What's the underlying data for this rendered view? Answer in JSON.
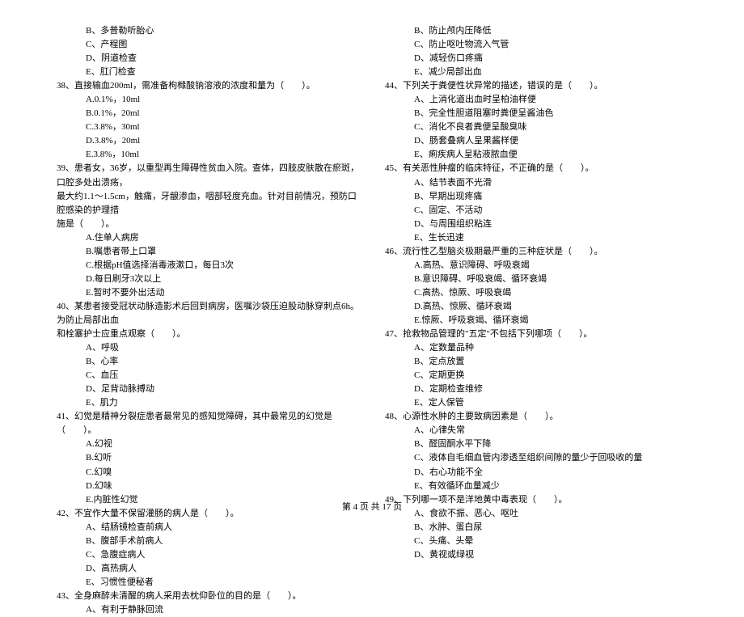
{
  "left": {
    "pre_opts": [
      "B、多普勒听胎心",
      "C、产程图",
      "D、阴道检查",
      "E、肛门检查"
    ],
    "q38": "38、直接输血200ml，需准备枸橼酸钠溶液的浓度和量为（　　）。",
    "q38_opts": [
      "A.0.1%，10ml",
      "B.0.1%，20ml",
      "C.3.8%，30ml",
      "D.3.8%，20ml",
      "E.3.8%，10ml"
    ],
    "q39a": "39、患者女，36岁，以重型再生障碍性贫血入院。查体，四肢皮肤散在瘀斑，口腔多处出溃疡，",
    "q39b": "最大约1.1～1.5cm，触痛，牙龈渗血，咽部轻度充血。针对目前情况，预防口腔感染的护理措",
    "q39c": "施是（　　）。",
    "q39_opts": [
      "A.住单人病房",
      "B.嘱患者带上口罩",
      "C.根据pH值选择消毒液漱口，每日3次",
      "D.每日刷牙3次以上",
      "E.暂时不要外出活动"
    ],
    "q40a": "40、某患者接受冠状动脉造影术后回到病房，医嘱沙袋压迫股动脉穿刺点6h。为防止局部出血",
    "q40b": "和栓塞护士应重点观察（　　）。",
    "q40_opts": [
      "A、呼吸",
      "B、心率",
      "C、血压",
      "D、足背动脉搏动",
      "E、肌力"
    ],
    "q41": "41、幻觉是精神分裂症患者最常见的感知觉障碍，其中最常见的幻觉是（　　）。",
    "q41_opts": [
      "A.幻视",
      "B.幻听",
      "C.幻嗅",
      "D.幻味",
      "E.内脏性幻觉"
    ],
    "q42": "42、不宜作大量不保留灌肠的病人是（　　）。",
    "q42_opts": [
      "A、结肠镜检查前病人",
      "B、腹部手术前病人",
      "C、急腹症病人",
      "D、高热病人",
      "E、习惯性便秘者"
    ],
    "q43": "43、全身麻醉未清醒的病人采用去枕仰卧位的目的是（　　）。",
    "q43_opts": [
      "A、有利于静脉回流"
    ]
  },
  "right": {
    "pre_opts": [
      "B、防止颅内压降低",
      "C、防止呕吐物流入气管",
      "D、减轻伤口疼痛",
      "E、减少局部出血"
    ],
    "q44": "44、下列关于粪便性状异常的描述，错误的是（　　）。",
    "q44_opts": [
      "A、上消化道出血时呈柏油样便",
      "B、完全性胆道阻塞时粪便呈酱油色",
      "C、消化不良者粪便呈酸臭味",
      "D、肠套叠病人呈果酱样便",
      "E、痢疾病人呈粘液脓血便"
    ],
    "q45": "45、有关恶性肿瘤的临床特征，不正确的是（　　）。",
    "q45_opts": [
      "A、结节表面不光滑",
      "B、早期出现疼痛",
      "C、固定、不活动",
      "D、与周围组织粘连",
      "E、生长迅速"
    ],
    "q46": "46、流行性乙型脑炎极期最严重的三种症状是（　　）。",
    "q46_opts": [
      "A.高热、意识障碍、呼吸衰竭",
      "B.意识障碍、呼吸衰竭、循环衰竭",
      "C.高热、惊厥、呼吸衰竭",
      "D.高热、惊厥、循环衰竭",
      "E.惊厥、呼吸衰竭、循环衰竭"
    ],
    "q47": "47、抢救物品管理的\"五定\"不包括下列哪项（　　）。",
    "q47_opts": [
      "A、定数量品种",
      "B、定点放置",
      "C、定期更换",
      "D、定期检查维修",
      "E、定人保管"
    ],
    "q48": "48、心源性水肿的主要致病因素是（　　）。",
    "q48_opts": [
      "A、心律失常",
      "B、醛固酮水平下降",
      "C、液体自毛细血管内渗透至组织间隙的量少于回吸收的量",
      "D、右心功能不全",
      "E、有效循环血量减少"
    ],
    "q49": "49、下列哪一项不是洋地黄中毒表现（　　）。",
    "q49_opts": [
      "A、食欲不振、恶心、呕吐",
      "B、水肿、蛋白尿",
      "C、头痛、头晕",
      "D、黄视或绿视"
    ]
  },
  "footer": "第 4 页 共 17 页"
}
